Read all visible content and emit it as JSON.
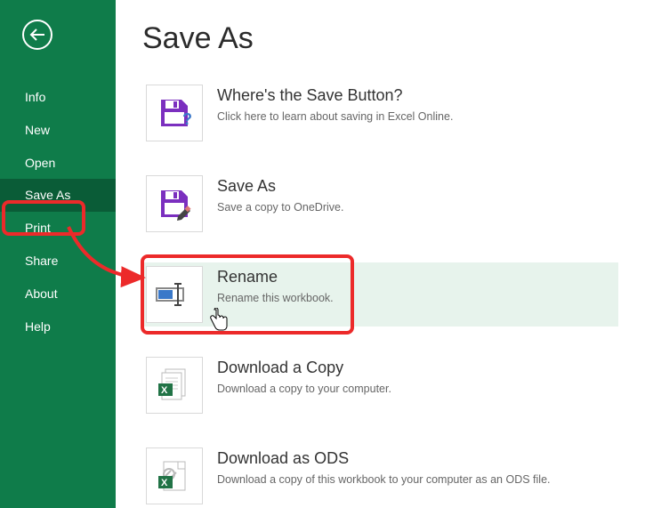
{
  "sidebar": {
    "items": [
      {
        "label": "Info"
      },
      {
        "label": "New"
      },
      {
        "label": "Open"
      },
      {
        "label": "Save As",
        "selected": true
      },
      {
        "label": "Print"
      },
      {
        "label": "Share"
      },
      {
        "label": "About"
      },
      {
        "label": "Help"
      }
    ]
  },
  "page": {
    "title": "Save As"
  },
  "options": [
    {
      "title": "Where's the Save Button?",
      "desc": "Click here to learn about saving in Excel Online.",
      "icon": "save-question-icon"
    },
    {
      "title": "Save As",
      "desc": "Save a copy to OneDrive.",
      "icon": "save-pencil-icon"
    },
    {
      "title": "Rename",
      "desc": "Rename this workbook.",
      "icon": "rename-icon",
      "highlight": true
    },
    {
      "title": "Download a Copy",
      "desc": "Download a copy to your computer.",
      "icon": "download-copy-icon"
    },
    {
      "title": "Download as ODS",
      "desc": "Download a copy of this workbook to your computer as an ODS file.",
      "icon": "download-ods-icon"
    }
  ],
  "colors": {
    "brand": "#0f7c4a",
    "accent": "#ec2a2a",
    "purple": "#7b2fbf",
    "excel": "#217346"
  }
}
